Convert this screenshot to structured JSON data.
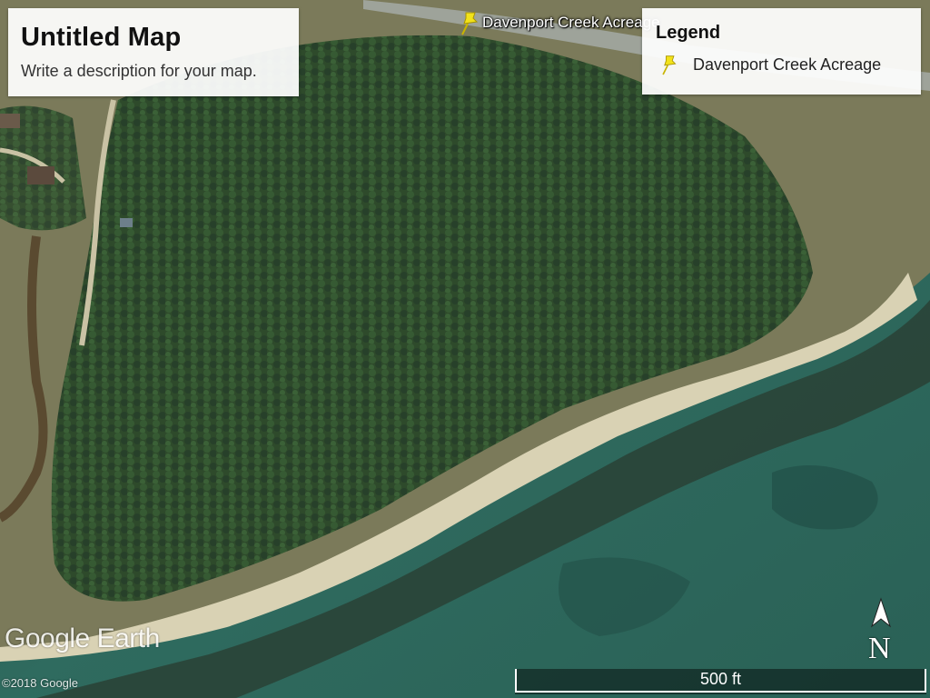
{
  "map": {
    "title": "Untitled Map",
    "description": "Write a description for your map."
  },
  "legend": {
    "title": "Legend",
    "items": [
      {
        "label": "Davenport Creek Acreage",
        "icon": "yellow-pushpin-icon",
        "color": "#f2e21a"
      }
    ]
  },
  "placemark": {
    "label": "Davenport Creek Acreage",
    "icon": "yellow-pushpin-icon"
  },
  "branding": {
    "logo_text": "Google Earth",
    "copyright": "©2018 Google"
  },
  "compass": {
    "label": "N"
  },
  "scale_bar": {
    "label": "500 ft"
  },
  "colors": {
    "forest": "#2f4a2c",
    "beach": "#d9d2b4",
    "water_shallow": "#2f6b5f",
    "water_deep": "#1f4b44",
    "road": "#9ea39a",
    "pin": "#f2e21a"
  }
}
